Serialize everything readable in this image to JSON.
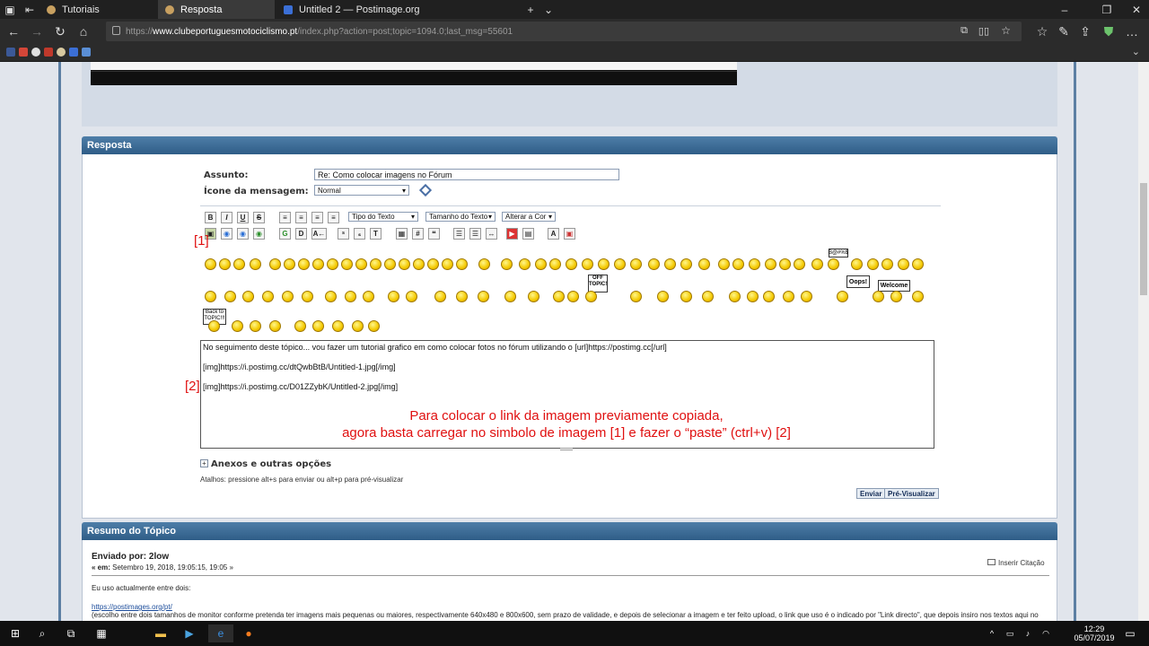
{
  "browser": {
    "tabs": [
      {
        "label": "Tutoriais"
      },
      {
        "label": "Resposta"
      },
      {
        "label": "Untitled 2 — Postimage.org"
      }
    ],
    "url_prefix": "https://",
    "url_host": "www.clubeportuguesmotociclismo.pt",
    "url_path": "/index.php?action=post;topic=1094.0;last_msg=55601"
  },
  "reply": {
    "header": "Resposta",
    "subject_label": "Assunto:",
    "subject_value": "Re: Como colocar imagens no Fórum",
    "icon_label": "Ícone da mensagem:",
    "icon_value": "Normal",
    "font_type": "Tipo do Texto",
    "font_size": "Tamanho do Texto",
    "font_color": "Alterar a Cor",
    "marker1": "[1]",
    "marker2": "[2]",
    "message_lines": [
      "No seguimento deste tópico... vou fazer um tutorial grafico em como colocar fotos no fórum utilizando o [url]https://postimg.cc[/url]",
      "[img]https://i.postimg.cc/dtQwbBtB/Untitled-1.jpg[/img]",
      "[img]https://i.postimg.cc/D01ZZybK/Untitled-2.jpg[/img]"
    ],
    "annotation_line1": "Para colocar o link da imagem previamente copiada,",
    "annotation_line2": "agora basta carregar no simbolo de imagem [1] e fazer o “paste” (ctrl+v) [2]",
    "attachments": "Anexos e outras opções",
    "shortcuts": "Atalhos: pressione alt+s para enviar ou alt+p para pré-visualizar",
    "send": "Enviar",
    "preview": "Pré-Visualizar",
    "smiley_labels": {
      "offtopic": "OFF TOPIC!",
      "oops": "Oops!",
      "welcome": "Welcome",
      "backtotopic": "Back to TOPIC!!!",
      "sign": "B@#%$"
    }
  },
  "summary": {
    "header": "Resumo do Tópico",
    "posted_by": "Enviado por: 2low",
    "date_prefix": "« em:",
    "date": "Setembro 19, 2018, 19:05:15, 19:05 »",
    "quote": "Inserir Citação",
    "body1": "Eu uso actualmente entre dois:",
    "link": "https://postimages.org/pt/",
    "body2": "(escolho entre dois tamanhos de monitor conforme pretenda ter imagens mais pequenas ou maiores, respectivamente 640x480 e 800x600, sem prazo de validade, e depois de selecionar a imagem e ter feito upload, o link que uso é o indicado por \"Link directo\", que depois insiro nos textos aqui no"
  },
  "taskbar": {
    "time": "12:29",
    "date": "05/07/2019"
  }
}
